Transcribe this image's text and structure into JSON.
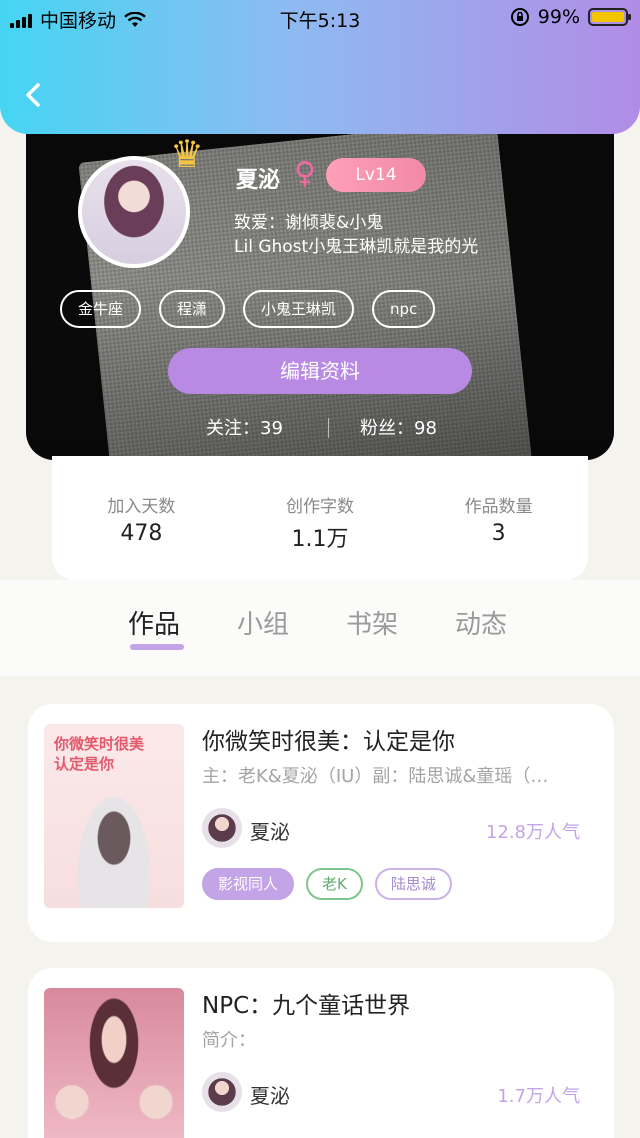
{
  "status_bar": {
    "carrier": "中国移动",
    "time": "下午5:13",
    "battery_percent": "99%",
    "battery_level": 0.99,
    "icons": [
      "signal-icon",
      "wifi-icon",
      "rotation-lock-icon",
      "battery-icon"
    ]
  },
  "header": {
    "back_icon": "chevron-left-icon"
  },
  "profile": {
    "name": "夏泌",
    "gender_symbol": "♀",
    "level": "Lv14",
    "bio_line1": "致爱：谢倾裴&小鬼",
    "bio_line2": "Lil Ghost小鬼王琳凯就是我的光",
    "tags": [
      "金牛座",
      "程潇",
      "小鬼王琳凯",
      "npc"
    ],
    "edit_button": "编辑资料",
    "follow_text": "关注：39",
    "fans_text": "粉丝：98",
    "accent_color": "#b98ae4"
  },
  "stats": [
    {
      "label": "加入天数",
      "value": "478"
    },
    {
      "label": "创作字数",
      "value": "1.1万"
    },
    {
      "label": "作品数量",
      "value": "3"
    }
  ],
  "tabs": [
    "作品",
    "小组",
    "书架",
    "动态"
  ],
  "active_tab": "作品",
  "works": [
    {
      "title": "你微笑时很美：认定是你",
      "desc": "主：老K&夏泌（IU）副：陆思诚&童瑶（…",
      "author": "夏泌",
      "popularity": "12.8万人气",
      "badges": [
        "影视同人",
        "老K",
        "陆思诚"
      ]
    },
    {
      "title": "NPC：九个童话世界",
      "desc": "简介：",
      "author": "夏泌",
      "popularity": "1.7万人气"
    }
  ]
}
